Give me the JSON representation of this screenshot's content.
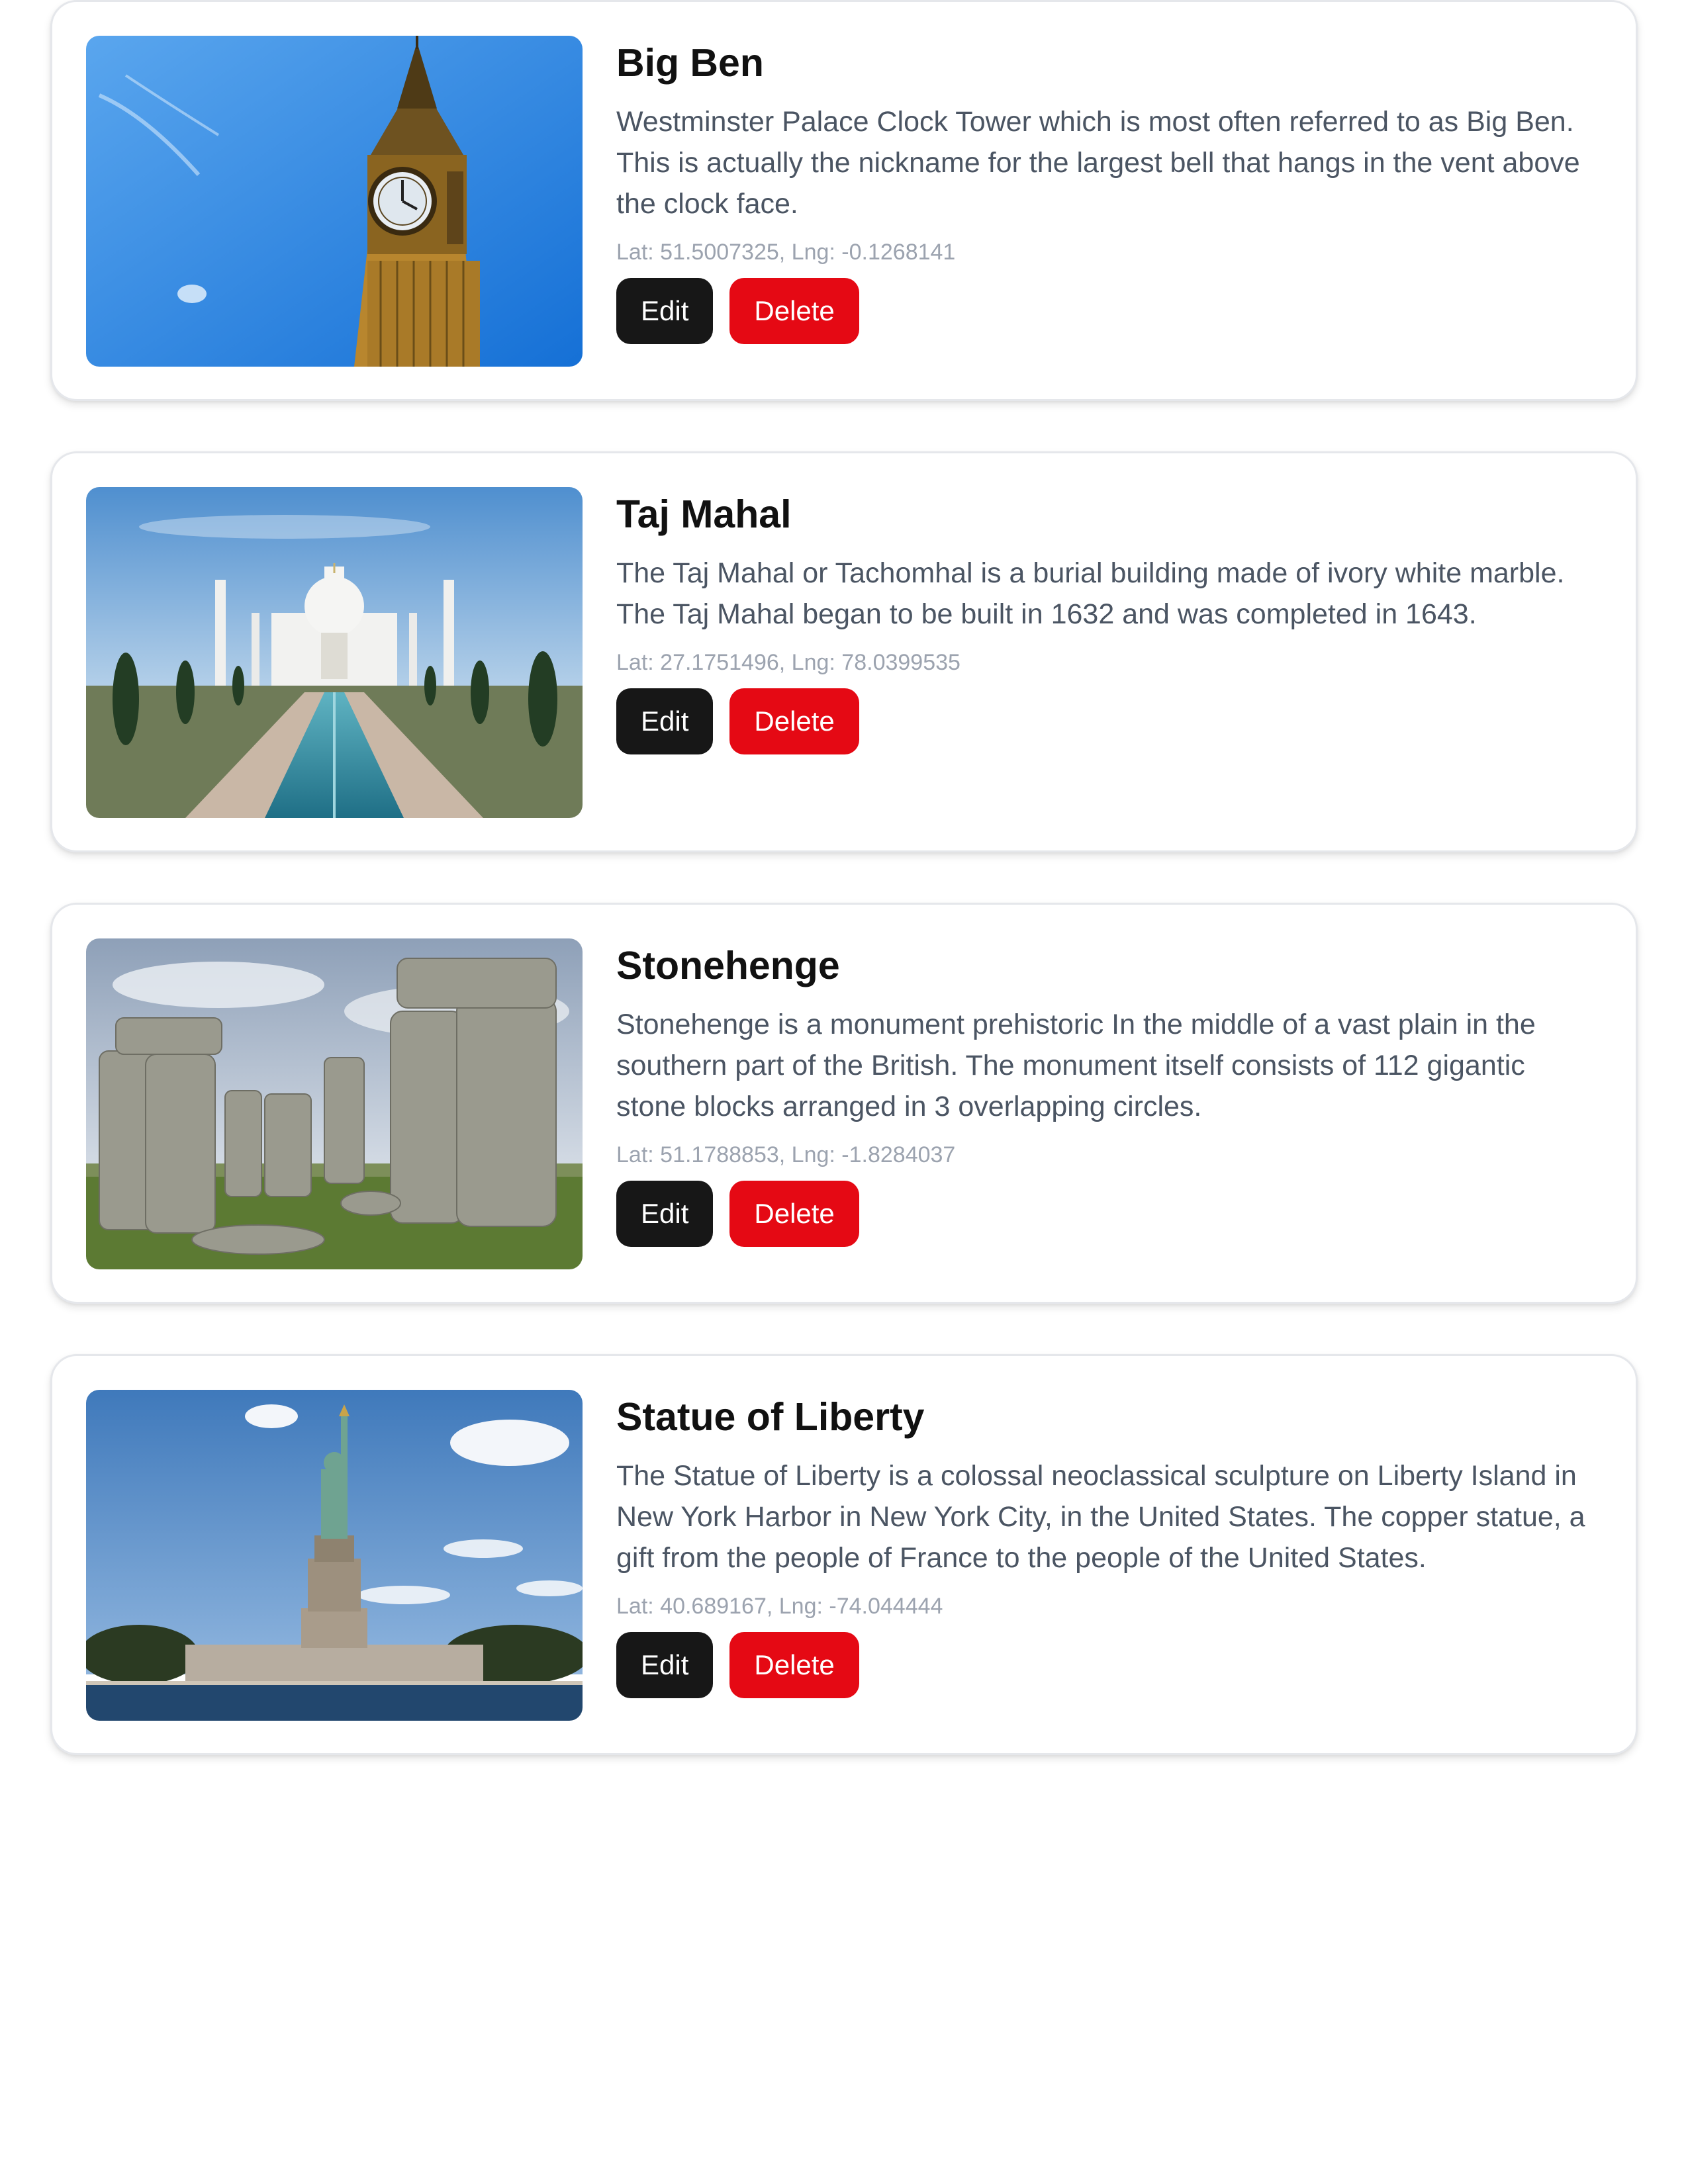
{
  "landmarks": [
    {
      "name": "Big Ben",
      "description": "Westminster Palace Clock Tower which is most often referred to as Big Ben. This is actually the nickname for the largest bell that hangs in the vent above the clock face.",
      "coords": "Lat: 51.5007325, Lng: -0.1268141",
      "edit_label": "Edit",
      "delete_label": "Delete"
    },
    {
      "name": "Taj Mahal",
      "description": "The Taj Mahal or Tachomhal is a burial building made of ivory white marble. The Taj Mahal began to be built in 1632 and was completed in 1643.",
      "coords": "Lat: 27.1751496, Lng: 78.0399535",
      "edit_label": "Edit",
      "delete_label": "Delete"
    },
    {
      "name": "Stonehenge",
      "description": "Stonehenge is a monument prehistoric In the middle of a vast plain in the southern part of the British. The monument itself consists of 112 gigantic stone blocks arranged in 3 overlapping circles.",
      "coords": "Lat: 51.1788853, Lng: -1.8284037",
      "edit_label": "Edit",
      "delete_label": "Delete"
    },
    {
      "name": "Statue of Liberty",
      "description": "The Statue of Liberty is a colossal neoclassical sculpture on Liberty Island in New York Harbor in New York City, in the United States. The copper statue, a gift from the people of France to the people of the United States.",
      "coords": "Lat: 40.689167, Lng: -74.044444",
      "edit_label": "Edit",
      "delete_label": "Delete"
    }
  ],
  "colors": {
    "edit_button": "#171717",
    "delete_button": "#e50914",
    "description_text": "#4b5563",
    "coords_text": "#9ca3af"
  }
}
